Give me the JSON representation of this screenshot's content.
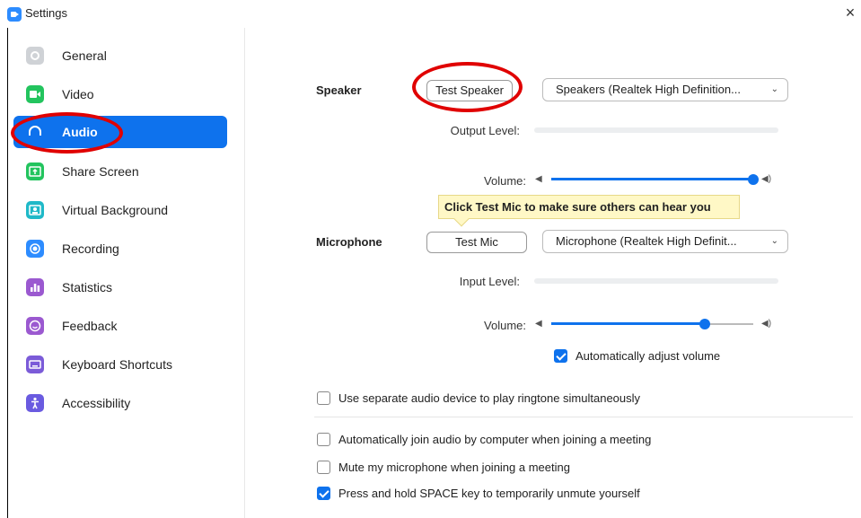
{
  "window": {
    "title": "Settings",
    "close_glyph": "×"
  },
  "sidebar": {
    "items": [
      {
        "label": "General",
        "icon": "gear-icon",
        "color": "#cfd2d6",
        "active": false
      },
      {
        "label": "Video",
        "icon": "video-camera-icon",
        "color": "#23c45e",
        "active": false
      },
      {
        "label": "Audio",
        "icon": "headphones-icon",
        "color": "#0e72ed",
        "active": true
      },
      {
        "label": "Share Screen",
        "icon": "share-screen-icon",
        "color": "#23c45e",
        "active": false
      },
      {
        "label": "Virtual Background",
        "icon": "virtual-background-icon",
        "color": "#1fb9c8",
        "active": false
      },
      {
        "label": "Recording",
        "icon": "record-icon",
        "color": "#2d8cff",
        "active": false
      },
      {
        "label": "Statistics",
        "icon": "statistics-icon",
        "color": "#9b59d0",
        "active": false
      },
      {
        "label": "Feedback",
        "icon": "feedback-smile-icon",
        "color": "#9b59d0",
        "active": false
      },
      {
        "label": "Keyboard Shortcuts",
        "icon": "keyboard-icon",
        "color": "#7b5bd8",
        "active": false
      },
      {
        "label": "Accessibility",
        "icon": "accessibility-icon",
        "color": "#6a5be0",
        "active": false
      }
    ]
  },
  "speaker": {
    "label": "Speaker",
    "test_button": "Test Speaker",
    "device": "Speakers (Realtek High Definition...",
    "output_level_label": "Output Level:",
    "output_level": 0,
    "volume_label": "Volume:",
    "volume": 1.0
  },
  "tooltip": {
    "text": "Click Test Mic to make sure others can hear you"
  },
  "microphone": {
    "label": "Microphone",
    "test_button": "Test Mic",
    "device": "Microphone (Realtek High Definit...",
    "input_level_label": "Input Level:",
    "input_level": 0,
    "volume_label": "Volume:",
    "volume": 0.76,
    "auto_adjust_label": "Automatically adjust volume",
    "auto_adjust": true
  },
  "options": [
    {
      "label": "Use separate audio device to play ringtone simultaneously",
      "checked": false
    },
    {
      "label": "Automatically join audio by computer when joining a meeting",
      "checked": false
    },
    {
      "label": "Mute my microphone when joining a meeting",
      "checked": false
    },
    {
      "label": "Press and hold SPACE key to temporarily unmute yourself",
      "checked": true
    }
  ],
  "colors": {
    "accent": "#0e72ed",
    "annotation": "#e00000",
    "tooltip_bg": "#fff8c6"
  }
}
